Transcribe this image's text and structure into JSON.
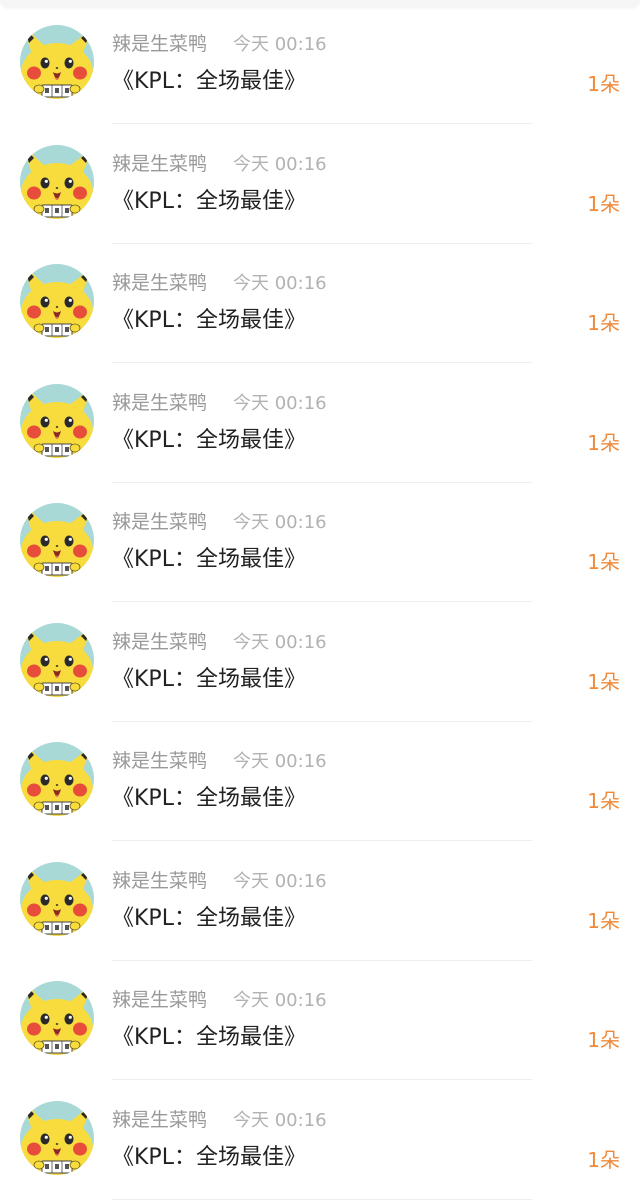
{
  "items": [
    {
      "name": "辣是生菜鸭",
      "time": "今天 00:16",
      "title": "《KPL：全场最佳》",
      "count": "1朵"
    },
    {
      "name": "辣是生菜鸭",
      "time": "今天 00:16",
      "title": "《KPL：全场最佳》",
      "count": "1朵"
    },
    {
      "name": "辣是生菜鸭",
      "time": "今天 00:16",
      "title": "《KPL：全场最佳》",
      "count": "1朵"
    },
    {
      "name": "辣是生菜鸭",
      "time": "今天 00:16",
      "title": "《KPL：全场最佳》",
      "count": "1朵"
    },
    {
      "name": "辣是生菜鸭",
      "time": "今天 00:16",
      "title": "《KPL：全场最佳》",
      "count": "1朵"
    },
    {
      "name": "辣是生菜鸭",
      "time": "今天 00:16",
      "title": "《KPL：全场最佳》",
      "count": "1朵"
    },
    {
      "name": "辣是生菜鸭",
      "time": "今天 00:16",
      "title": "《KPL：全场最佳》",
      "count": "1朵"
    },
    {
      "name": "辣是生菜鸭",
      "time": "今天 00:16",
      "title": "《KPL：全场最佳》",
      "count": "1朵"
    },
    {
      "name": "辣是生菜鸭",
      "time": "今天 00:16",
      "title": "《KPL：全场最佳》",
      "count": "1朵"
    },
    {
      "name": "辣是生菜鸭",
      "time": "今天 00:16",
      "title": "《KPL：全场最佳》",
      "count": "1朵"
    }
  ],
  "avatar_icon": "pikachu-avatar-icon",
  "colors": {
    "accent": "#f08a3a",
    "name_text": "#999999",
    "time_text": "#b2b2b2",
    "title_text": "#222222",
    "avatar_bg": "#a9d9d7",
    "avatar_face": "#f8dc3d",
    "avatar_cheek": "#e84c3a"
  }
}
